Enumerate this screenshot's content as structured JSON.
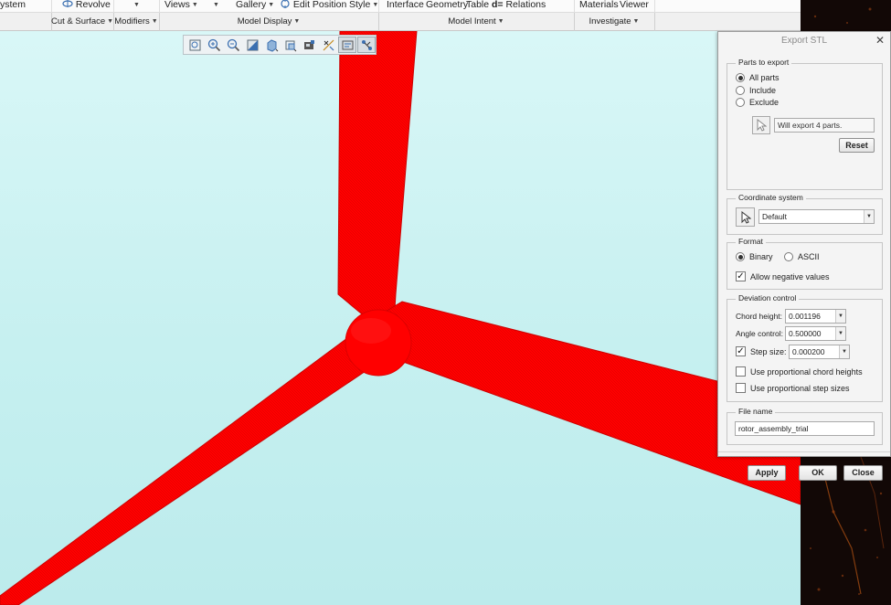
{
  "ribbon": {
    "top_items": [
      {
        "label": "ystem",
        "caret": ""
      },
      {
        "label": "Revolve",
        "caret": ""
      },
      {
        "label": "",
        "caret": "▼"
      },
      {
        "label": "Views",
        "caret": "▼"
      },
      {
        "label": "Gallery",
        "caret": "▼"
      },
      {
        "label": "Edit Position",
        "caret": ""
      },
      {
        "label": "Style",
        "caret": "▼"
      },
      {
        "label": "Interface",
        "caret": ""
      },
      {
        "label": "Geometry",
        "caret": ""
      },
      {
        "label": "Table",
        "caret": ""
      },
      {
        "label": "Relations",
        "caret": ""
      },
      {
        "label": "Materials",
        "caret": ""
      },
      {
        "label": "Viewer",
        "caret": ""
      }
    ],
    "relations_prefix": "d=",
    "groups": [
      {
        "label": "Cut & Surface",
        "caret": "▼"
      },
      {
        "label": "Modifiers",
        "caret": "▼"
      },
      {
        "label": "Model Display",
        "caret": "▼"
      },
      {
        "label": "Model Intent",
        "caret": "▼"
      },
      {
        "label": "Investigate",
        "caret": "▼"
      }
    ]
  },
  "graphics_toolbar": {
    "buttons": [
      {
        "icon": "refit-icon",
        "active": false
      },
      {
        "icon": "zoom-in-icon",
        "active": false
      },
      {
        "icon": "zoom-out-icon",
        "active": false
      },
      {
        "icon": "repaint-icon",
        "active": false
      },
      {
        "icon": "display-style-icon",
        "active": false
      },
      {
        "icon": "saved-orientations-icon",
        "active": false
      },
      {
        "icon": "view-manager-icon",
        "active": false
      },
      {
        "icon": "datum-display-icon",
        "active": false
      },
      {
        "icon": "spin-center-icon",
        "active": true
      },
      {
        "icon": "annotation-display-icon",
        "active": true
      }
    ]
  },
  "scene": {
    "model_color": "#ff0000",
    "background_top": "#d9f7f7",
    "background_bottom": "#bcebec"
  },
  "dialog": {
    "title": "Export STL",
    "close_glyph": "✕",
    "parts": {
      "title": "Parts to export",
      "options": [
        "All parts",
        "Include",
        "Exclude"
      ],
      "selected": "All parts",
      "info": "Will export 4 parts.",
      "reset_label": "Reset"
    },
    "coordinate": {
      "title": "Coordinate system",
      "value": "Default"
    },
    "format": {
      "title": "Format",
      "options": [
        "Binary",
        "ASCII"
      ],
      "selected": "Binary",
      "allow_negative_label": "Allow negative values",
      "allow_negative_checked": true
    },
    "deviation": {
      "title": "Deviation control",
      "chord_height_label": "Chord height:",
      "chord_height_value": "0.001196",
      "angle_control_label": "Angle control:",
      "angle_control_value": "0.500000",
      "step_size_label": "Step size:",
      "step_size_value": "0.000200",
      "step_size_checked": true,
      "prop_chord_label": "Use proportional chord heights",
      "prop_chord_checked": false,
      "prop_step_label": "Use proportional step sizes",
      "prop_step_checked": false
    },
    "file": {
      "title": "File name",
      "value": "rotor_assembly_trial"
    },
    "buttons": {
      "apply": "Apply",
      "ok": "OK",
      "close": "Close"
    }
  }
}
